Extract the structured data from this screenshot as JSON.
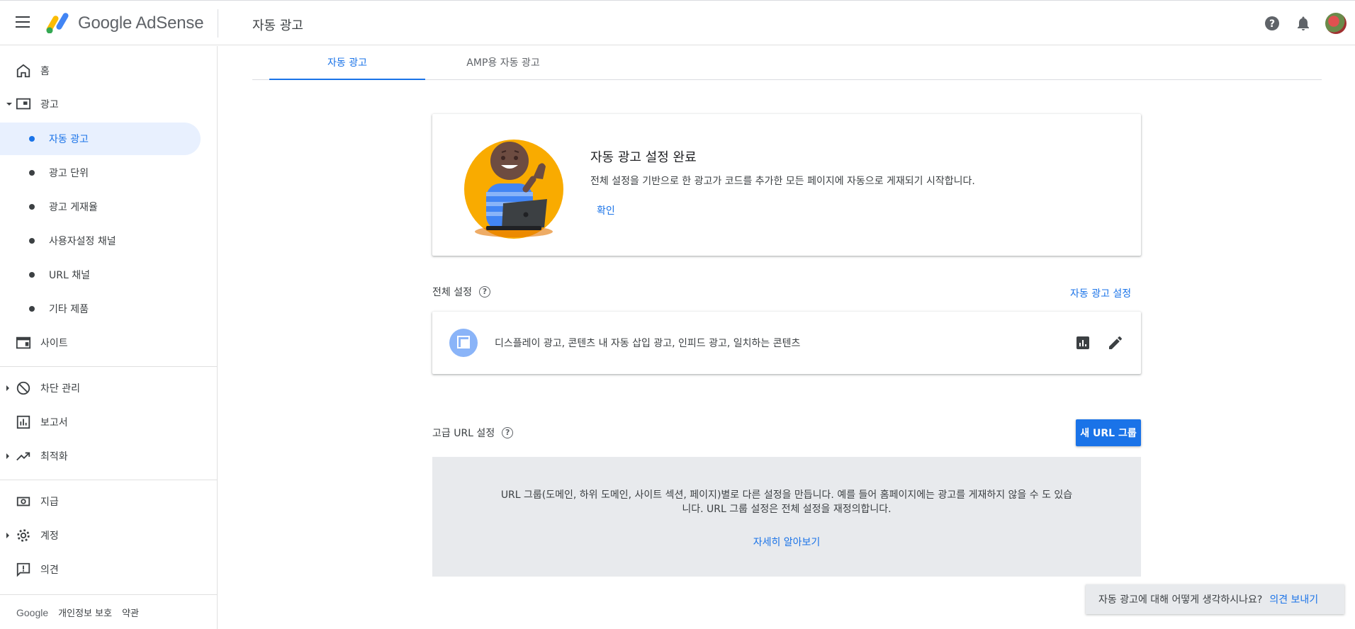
{
  "header": {
    "brand": "Google AdSense",
    "page_title": "자동 광고",
    "help_icon": "help-circle-icon",
    "bell_icon": "notifications-bell-icon"
  },
  "sidebar": {
    "home": "홈",
    "ads": "광고",
    "ads_children": [
      "자동 광고",
      "광고 단위",
      "광고 게재율",
      "사용자설정 채널",
      "URL 채널",
      "기타 제품"
    ],
    "sites": "사이트",
    "blocking": "차단 관리",
    "reports": "보고서",
    "optimization": "최적화",
    "payments": "지급",
    "account": "계정",
    "feedback": "의견",
    "footer": {
      "google": "Google",
      "privacy": "개인정보 보호",
      "terms": "약관"
    }
  },
  "tabs": [
    "자동 광고",
    "AMP용 자동 광고"
  ],
  "done_card": {
    "title": "자동 광고 설정 완료",
    "description": "전체 설정을 기반으로 한 광고가 코드를 추가한 모든 페이지에 자동으로 게재되기 시작합니다.",
    "confirm": "확인"
  },
  "global_settings": {
    "label": "전체 설정",
    "link": "자동 광고 설정",
    "summary": "디스플레이 광고, 콘텐츠 내 자동 삽입 광고, 인피드 광고, 일치하는 콘텐츠"
  },
  "advanced_url": {
    "label": "고급 URL 설정",
    "button": "새 URL 그룹",
    "description": "URL 그룹(도메인, 하위 도메인, 사이트 섹션, 페이지)별로 다른 설정을 만듭니다. 예를 들어 홈페이지에는 광고를 게재하지 않을 수 도 있습니다. URL 그룹 설정은 전체 설정을 재정의합니다.",
    "learn_more": "자세히 알아보기"
  },
  "feedback_bar": {
    "question": "자동 광고에 대해 어떻게 생각하시나요?",
    "link": "의견 보내기"
  },
  "colors": {
    "accent": "#1a73e8",
    "active_bg": "#e8f0fe",
    "panel_bg": "#e8eaed"
  }
}
